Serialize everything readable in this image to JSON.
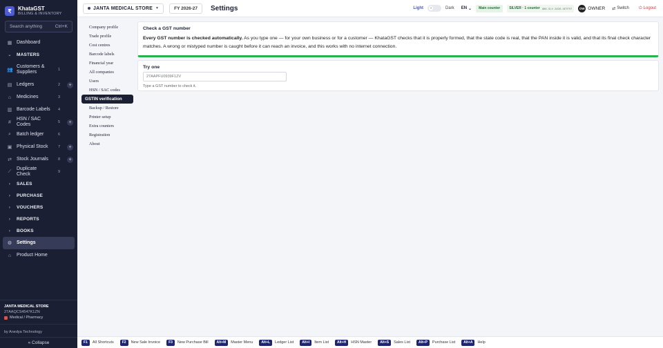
{
  "brand": {
    "logo": "₹",
    "name": "KhataGST",
    "subtitle": "BILLING & INVENTORY"
  },
  "search": {
    "placeholder": "Search anything",
    "shortcut": "Ctrl+K"
  },
  "sidebar": {
    "dashboard": "Dashboard",
    "masters_section": "MASTERS",
    "masters": [
      {
        "label": "Customers & Suppliers",
        "count": "1",
        "plus": false,
        "icon": "users-icon"
      },
      {
        "label": "Ledgers",
        "count": "2",
        "plus": true,
        "icon": "ledger-icon"
      },
      {
        "label": "Medicines",
        "count": "3",
        "plus": false,
        "icon": "tag-icon"
      },
      {
        "label": "Barcode Labels",
        "count": "4",
        "plus": false,
        "icon": "barcode-icon"
      },
      {
        "label": "HSN / SAC Codes",
        "count": "5",
        "plus": true,
        "icon": "hash-icon"
      },
      {
        "label": "Batch ledger",
        "count": "6",
        "plus": false,
        "icon": "search-icon"
      },
      {
        "label": "Physical Stock",
        "count": "7",
        "plus": true,
        "icon": "box-icon"
      },
      {
        "label": "Stock Journals",
        "count": "8",
        "plus": true,
        "icon": "shuffle-icon"
      },
      {
        "label": "Duplicate Check",
        "count": "9",
        "plus": false,
        "icon": "wand-icon"
      }
    ],
    "sections": [
      "SALES",
      "PURCHASE",
      "VOUCHERS",
      "REPORTS",
      "BOOKS"
    ],
    "settings": "Settings",
    "product_home": "Product Home"
  },
  "store_info": {
    "name": "JANTA MEDICAL STORE",
    "gstin": "27AAQCS4547K1ZN",
    "category": "Medical / Pharmacy"
  },
  "by": "by Anedya Technology",
  "collapse": "« Collapse",
  "topbar": {
    "store": "JANTA MEDICAL STORE",
    "fy": "FY 2026-27",
    "title": "Settings",
    "light": "Light",
    "dark": "Dark",
    "lang": "EN",
    "main_counter": "Main counter",
    "plan": "SILVER · 1 counter",
    "license": "ANX-SLV-2026-4E7F97",
    "owner_initials": "OW",
    "owner": "OWNER",
    "switch": "Switch",
    "logout": "Logout"
  },
  "submenu": [
    "Company profile",
    "Trade profile",
    "Cost centres",
    "Barcode labels",
    "Financial year",
    "All companies",
    "Users",
    "HSN / SAC codes",
    "GSTIN verification",
    "Backup / Restore",
    "Printer setup",
    "Extra counters",
    "Registration",
    "About"
  ],
  "submenu_active": 8,
  "card1": {
    "title": "Check a GST number",
    "bold": "Every GST number is checked automatically.",
    "body": " As you type one — for your own business or for a customer — KhataGST checks that it is properly formed, that the state code is real, that the PAN inside it is valid, and that its final check character matches. A wrong or mistyped number is caught before it can reach an invoice, and this works with no internet connection."
  },
  "card2": {
    "title": "Try one",
    "placeholder": "27AAPFU0939F1ZV",
    "hint": "Type a GST number to check it."
  },
  "shortcuts": [
    {
      "key": "F1",
      "label": "All Shortcuts"
    },
    {
      "key": "F2",
      "label": "New Sale Invoice"
    },
    {
      "key": "F3",
      "label": "New Purchase Bill"
    },
    {
      "key": "Alt+M",
      "label": "Master Menu"
    },
    {
      "key": "Alt+L",
      "label": "Ledger List"
    },
    {
      "key": "Alt+I",
      "label": "Item List"
    },
    {
      "key": "Alt+H",
      "label": "HSN Master"
    },
    {
      "key": "Alt+S",
      "label": "Sales List"
    },
    {
      "key": "Alt+P",
      "label": "Purchase List"
    },
    {
      "key": "Alt+A",
      "label": "Help"
    }
  ]
}
